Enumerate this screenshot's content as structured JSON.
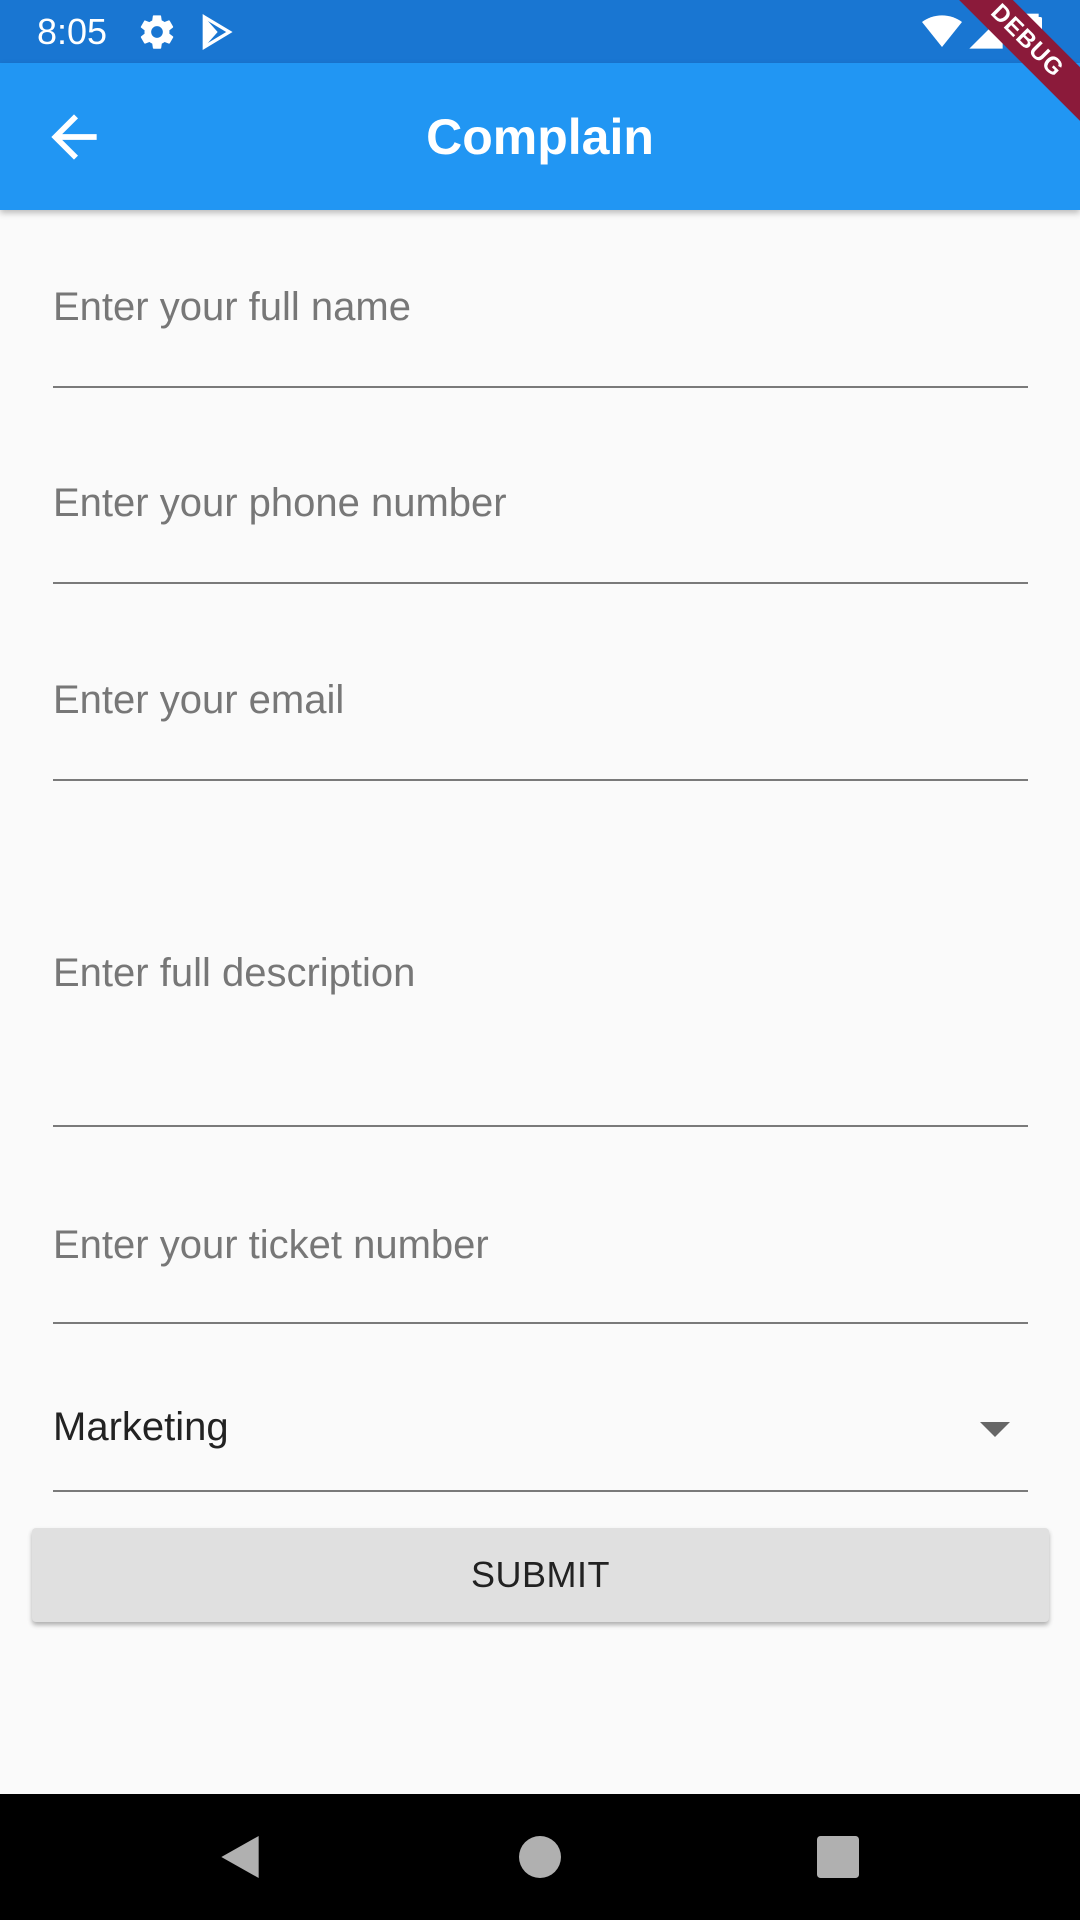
{
  "status_bar": {
    "time": "8:05",
    "icons": [
      "gear-icon",
      "play-store-icon",
      "wifi-icon",
      "signal-icon",
      "battery-icon"
    ]
  },
  "debug_banner": {
    "label": "DEBUG"
  },
  "app_bar": {
    "title": "Complain",
    "back_icon": "arrow-back-icon",
    "background": "#2196f3"
  },
  "form": {
    "full_name_placeholder": "Enter your full name",
    "phone_placeholder": "Enter your phone number",
    "email_placeholder": "Enter your email",
    "description_placeholder": "Enter full description",
    "ticket_placeholder": "Enter your ticket number",
    "category_selected": "Marketing",
    "submit_label": "SUBMIT"
  },
  "nav_bar": {
    "icons": [
      "back-triangle-icon",
      "home-circle-icon",
      "recents-square-icon"
    ]
  }
}
